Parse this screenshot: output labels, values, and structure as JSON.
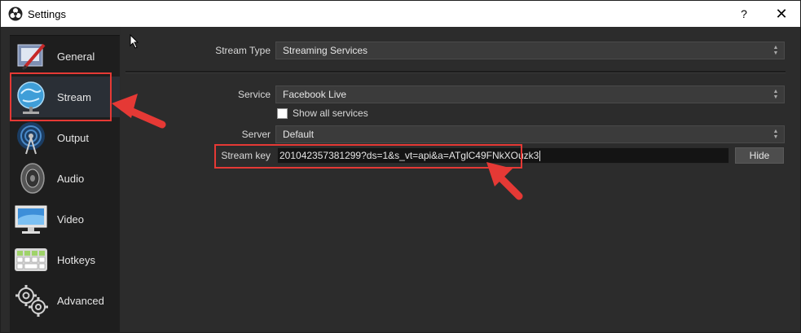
{
  "window": {
    "title": "Settings",
    "help_label": "?",
    "close_label": "✕"
  },
  "sidebar": {
    "items": [
      {
        "label": "General",
        "icon": "general-icon"
      },
      {
        "label": "Stream",
        "icon": "stream-globe-icon",
        "selected": true
      },
      {
        "label": "Output",
        "icon": "output-antenna-icon"
      },
      {
        "label": "Audio",
        "icon": "speaker-icon"
      },
      {
        "label": "Video",
        "icon": "monitor-icon"
      },
      {
        "label": "Hotkeys",
        "icon": "keyboard-icon"
      },
      {
        "label": "Advanced",
        "icon": "gears-icon"
      }
    ]
  },
  "stream": {
    "stream_type_label": "Stream Type",
    "stream_type_value": "Streaming Services",
    "service_label": "Service",
    "service_value": "Facebook Live",
    "show_all_label": "Show all services",
    "server_label": "Server",
    "server_value": "Default",
    "key_label": "Stream key",
    "key_value": "201042357381299?ds=1&s_vt=api&a=ATglC49FNkXOuzk3",
    "hide_label": "Hide"
  },
  "annotations": {
    "color": "#e53935"
  }
}
